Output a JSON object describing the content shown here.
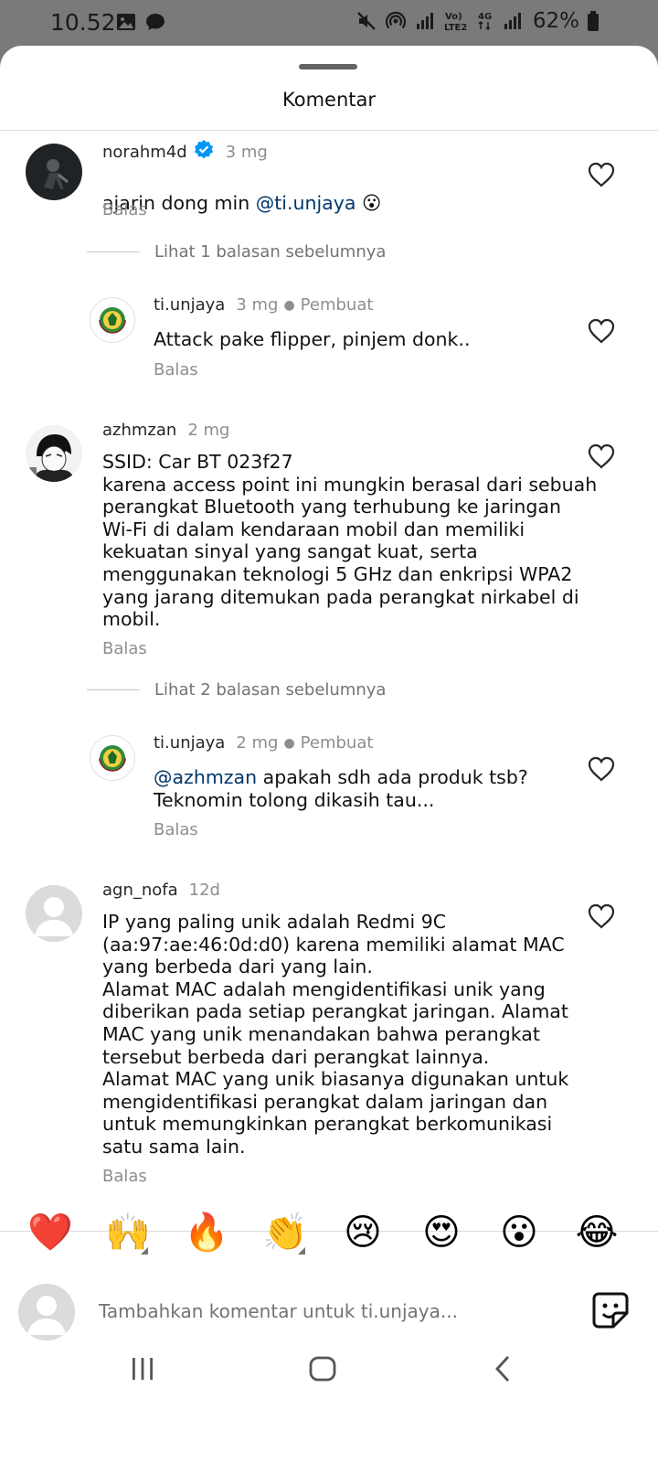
{
  "status_bar": {
    "time": "10.52",
    "battery": "62%",
    "icons": [
      "image-icon",
      "chat-bubble-icon",
      "mute-icon",
      "hotspot-icon",
      "signal-icon",
      "volte-icon",
      "4g-icon",
      "signal-icon",
      "battery-icon"
    ]
  },
  "sheet": {
    "title": "Komentar"
  },
  "comments": [
    {
      "username": "norahm4d",
      "verified": true,
      "time": "3 mg",
      "text_pre": "ajarin dong min ",
      "mention": "@ti.unjaya",
      "emoji": "😮",
      "reply_label": "Balas"
    },
    {
      "view_replies": "Lihat 1 balasan sebelumnya"
    },
    {
      "username": "ti.unjaya",
      "time": "3 mg",
      "author_label": "Pembuat",
      "text": "Attack pake flipper, pinjem donk..",
      "reply_label": "Balas"
    },
    {
      "username": "azhmzan",
      "time": "2 mg",
      "text": "SSID: Car BT 023f27\nkarena access point ini mungkin berasal dari sebuah\nperangkat Bluetooth yang terhubung ke jaringan\nWi-Fi di dalam kendaraan mobil dan memiliki\nkekuatan sinyal yang sangat kuat, serta\nmenggunakan teknologi 5 GHz dan enkripsi WPA2\nyang jarang ditemukan pada perangkat nirkabel di\nmobil.",
      "reply_label": "Balas"
    },
    {
      "view_replies": "Lihat 2 balasan sebelumnya"
    },
    {
      "username": "ti.unjaya",
      "time": "2 mg",
      "author_label": "Pembuat",
      "mention": "@azhmzan",
      "text_post": " apakah sdh ada produk tsb?\nTeknomin tolong dikasih tau...",
      "reply_label": "Balas"
    },
    {
      "username": "agn_nofa",
      "time": "12d",
      "text": "IP yang paling unik adalah Redmi 9C\n(aa:97:ae:46:0d:d0) karena memiliki alamat MAC\nyang berbeda dari yang lain.\nAlamat MAC adalah mengidentifikasi unik yang\ndiberikan pada setiap perangkat jaringan. Alamat\nMAC yang unik menandakan bahwa perangkat\ntersebut berbeda dari perangkat lainnya.\nAlamat MAC yang unik biasanya digunakan untuk\nmengidentifikasi perangkat dalam jaringan dan\nuntuk memungkinkan perangkat berkomunikasi\nsatu sama lain.",
      "reply_label": "Balas"
    }
  ],
  "emoji_bar": [
    "❤️",
    "🙌",
    "🔥",
    "👏",
    "😢",
    "😍",
    "😮",
    "😂"
  ],
  "composer": {
    "placeholder": "Tambahkan komentar untuk ti.unjaya..."
  },
  "nav": [
    "recent-apps-icon",
    "home-icon",
    "back-icon"
  ],
  "colors": {
    "mention": "#00376b",
    "secondary_text": "#8e8e8e",
    "verified": "#0095f6",
    "status_bar_bg": "#7a7a7a"
  }
}
